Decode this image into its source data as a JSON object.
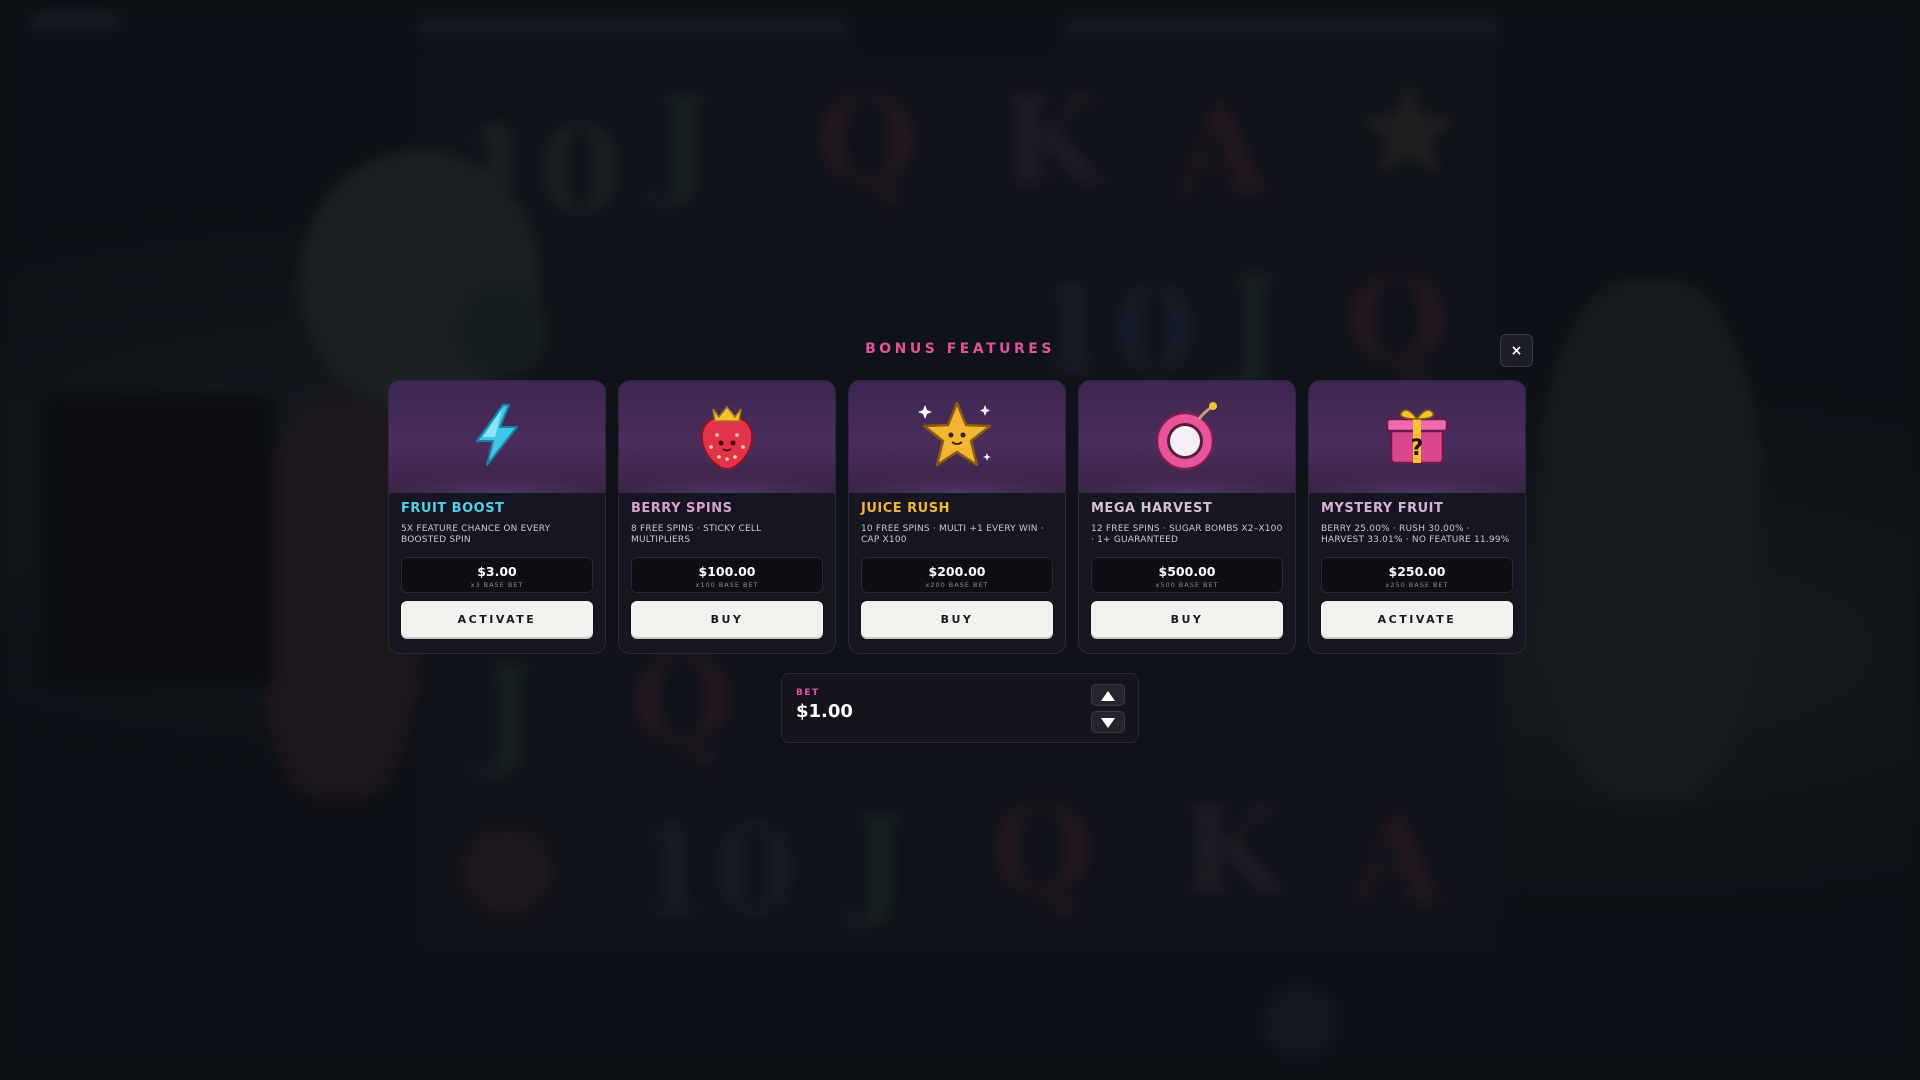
{
  "modal": {
    "title": "BONUS FEATURES",
    "close_label": "×"
  },
  "cards": [
    {
      "name": "FRUIT BOOST",
      "icon": "lightning-icon",
      "name_color": "#4fd3e6",
      "desc": "5X FEATURE CHANCE ON EVERY BOOSTED SPIN",
      "price": "$3.00",
      "price_sub": "x3 BASE BET",
      "action": "ACTIVATE"
    },
    {
      "name": "BERRY SPINS",
      "icon": "strawberry-icon",
      "name_color": "#d9a3c8",
      "desc": "8 FREE SPINS · STICKY CELL MULTIPLIERS",
      "price": "$100.00",
      "price_sub": "x100 BASE BET",
      "action": "BUY"
    },
    {
      "name": "JUICE RUSH",
      "icon": "star-icon",
      "name_color": "#f2b632",
      "desc": "10 FREE SPINS · MULTI +1 EVERY WIN · CAP X100",
      "price": "$200.00",
      "price_sub": "x200 BASE BET",
      "action": "BUY"
    },
    {
      "name": "MEGA HARVEST",
      "icon": "bomb-icon",
      "name_color": "#d6c2cf",
      "desc": "12 FREE SPINS · SUGAR BOMBS X2–X100 · 1+ GUARANTEED",
      "price": "$500.00",
      "price_sub": "x500 BASE BET",
      "action": "BUY"
    },
    {
      "name": "MYSTERY FRUIT",
      "icon": "mystery-box-icon",
      "name_color": "#d8b3cf",
      "desc": "BERRY 25.00% · RUSH 30.00% · HARVEST 33.01% · NO FEATURE 11.99%",
      "price": "$250.00",
      "price_sub": "x250 BASE BET",
      "action": "ACTIVATE"
    }
  ],
  "bet": {
    "label": "BET",
    "value": "$1.00"
  },
  "colors": {
    "accent": "#e0529a",
    "card_bg": "#171521",
    "button_bg": "#f3f1ee"
  }
}
